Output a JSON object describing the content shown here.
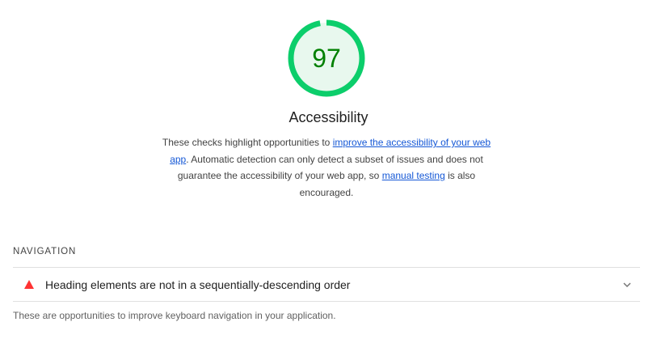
{
  "category": {
    "score": "97",
    "score_fraction": 0.97,
    "title": "Accessibility",
    "description": {
      "part1": "These checks highlight opportunities to ",
      "link1": "improve the accessibility of your web app",
      "part2": ". Automatic detection can only detect a subset of issues and does not guarantee the accessibility of your web app, so ",
      "link2": "manual testing",
      "part3": " is also encouraged."
    },
    "colors": {
      "pass_ring": "#0cce6b",
      "pass_fill": "#e8f8ee",
      "pass_text": "#008000",
      "fail_icon": "#ff3333",
      "link": "#1558d6"
    }
  },
  "group": {
    "title": "NAVIGATION",
    "audits": [
      {
        "icon": "fail-triangle-icon",
        "title": "Heading elements are not in a sequentially-descending order",
        "expand_icon": "chevron-down-icon"
      }
    ],
    "description": "These are opportunities to improve keyboard navigation in your application."
  }
}
